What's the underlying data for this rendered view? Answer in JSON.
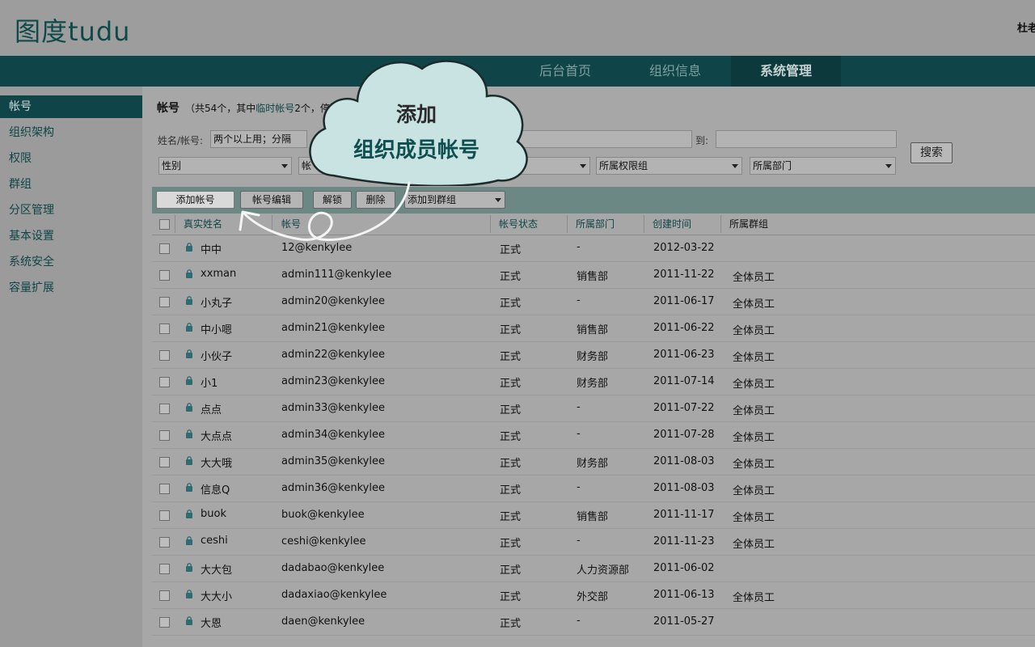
{
  "header": {
    "logo": "图度tudu",
    "user_name": "杜老"
  },
  "nav": {
    "tabs": [
      {
        "label": "后台首页",
        "active": false
      },
      {
        "label": "组织信息",
        "active": false
      },
      {
        "label": "系统管理",
        "active": true
      }
    ]
  },
  "sidebar": {
    "items": [
      {
        "label": "帐号",
        "active": true
      },
      {
        "label": "组织架构",
        "active": false
      },
      {
        "label": "权限",
        "active": false
      },
      {
        "label": "群组",
        "active": false
      },
      {
        "label": "分区管理",
        "active": false
      },
      {
        "label": "基本设置",
        "active": false
      },
      {
        "label": "系统安全",
        "active": false
      },
      {
        "label": "容量扩展",
        "active": false
      }
    ]
  },
  "main": {
    "title": "帐号",
    "summary_prefix": "（共54个，其中",
    "summary_link": "临时帐号",
    "summary_suffix": "2个，停用帐",
    "filters": {
      "name_label": "姓名/帐号:",
      "name_value": "两个以上用；分隔",
      "to_label": "到:",
      "gender_select": "性别",
      "account_select": "帐",
      "role_select": "所属权限组",
      "dept_select": "所属部门",
      "search_button": "搜索"
    },
    "toolbar": {
      "add": "添加帐号",
      "edit": "帐号编辑",
      "unlock": "解锁",
      "delete": "删除",
      "add_to_group": "添加到群组"
    },
    "columns": {
      "realname": "真实姓名",
      "account": "帐号",
      "status": "帐号状态",
      "dept": "所属部门",
      "created": "创建时间",
      "group": "所属群组"
    },
    "rows": [
      {
        "name": "中中",
        "account": "12@kenkylee",
        "status": "正式",
        "dept": "-",
        "date": "2012-03-22",
        "group": ""
      },
      {
        "name": "xxman",
        "account": "admin111@kenkylee",
        "status": "正式",
        "dept": "销售部",
        "date": "2011-11-22",
        "group": "全体员工"
      },
      {
        "name": "小丸子",
        "account": "admin20@kenkylee",
        "status": "正式",
        "dept": "-",
        "date": "2011-06-17",
        "group": "全体员工"
      },
      {
        "name": "中小嗯",
        "account": "admin21@kenkylee",
        "status": "正式",
        "dept": "销售部",
        "date": "2011-06-22",
        "group": "全体员工"
      },
      {
        "name": "小伙子",
        "account": "admin22@kenkylee",
        "status": "正式",
        "dept": "财务部",
        "date": "2011-06-23",
        "group": "全体员工"
      },
      {
        "name": "小1",
        "account": "admin23@kenkylee",
        "status": "正式",
        "dept": "财务部",
        "date": "2011-07-14",
        "group": "全体员工"
      },
      {
        "name": "点点",
        "account": "admin33@kenkylee",
        "status": "正式",
        "dept": "-",
        "date": "2011-07-22",
        "group": "全体员工"
      },
      {
        "name": "大点点",
        "account": "admin34@kenkylee",
        "status": "正式",
        "dept": "-",
        "date": "2011-07-28",
        "group": "全体员工"
      },
      {
        "name": "大大哦",
        "account": "admin35@kenkylee",
        "status": "正式",
        "dept": "财务部",
        "date": "2011-08-03",
        "group": "全体员工"
      },
      {
        "name": "信息Q",
        "account": "admin36@kenkylee",
        "status": "正式",
        "dept": "-",
        "date": "2011-08-03",
        "group": "全体员工"
      },
      {
        "name": "buok",
        "account": "buok@kenkylee",
        "status": "正式",
        "dept": "销售部",
        "date": "2011-11-17",
        "group": "全体员工"
      },
      {
        "name": "ceshi",
        "account": "ceshi@kenkylee",
        "status": "正式",
        "dept": "-",
        "date": "2011-11-23",
        "group": "全体员工"
      },
      {
        "name": "大大包",
        "account": "dadabao@kenkylee",
        "status": "正式",
        "dept": "人力资源部",
        "date": "2011-06-02",
        "group": ""
      },
      {
        "name": "大大小",
        "account": "dadaxiao@kenkylee",
        "status": "正式",
        "dept": "外交部",
        "date": "2011-06-13",
        "group": "全体员工"
      },
      {
        "name": "大恩",
        "account": "daen@kenkylee",
        "status": "正式",
        "dept": "-",
        "date": "2011-05-27",
        "group": ""
      }
    ]
  },
  "callout": {
    "line1": "添加",
    "line2": "组织成员帐号"
  },
  "colors": {
    "brand": "#0f4548",
    "toolbar": "#6b8885",
    "cloud": "#c9e3e3"
  }
}
